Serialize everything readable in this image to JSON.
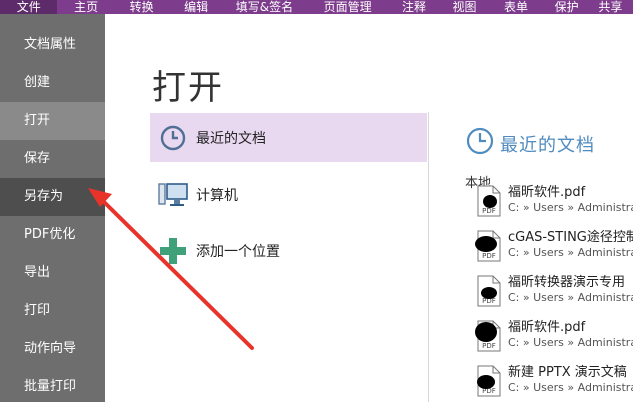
{
  "colors": {
    "menubar": "#7e3d8c",
    "sidebar": "#6e6e6e",
    "selected_place": "#e8d8f0",
    "accent": "#4f8bbf",
    "annotation_arrow": "#e8332a"
  },
  "menubar": {
    "tabs": [
      "文件",
      "主页",
      "转换",
      "编辑",
      "填写&签名",
      "页面管理",
      "注释",
      "视图",
      "表单",
      "保护",
      "共享"
    ]
  },
  "sidebar": {
    "items": [
      "文档属性",
      "创建",
      "打开",
      "保存",
      "另存为",
      "PDF优化",
      "导出",
      "打印",
      "动作向导",
      "批量打印"
    ]
  },
  "main": {
    "title": "打开",
    "places": [
      {
        "label": "最近的文档",
        "icon": "clock-icon"
      },
      {
        "label": "计算机",
        "icon": "computer-icon"
      },
      {
        "label": "添加一个位置",
        "icon": "plus-icon"
      }
    ]
  },
  "recent": {
    "title": "最近的文档",
    "section": "本地",
    "files": [
      {
        "name": "福昕软件.pdf",
        "path": "C: » Users » Administra"
      },
      {
        "name": "cGAS-STING途径控制",
        "path": "C: » Users » Administra"
      },
      {
        "name": "福昕转换器演示专用",
        "path": "C: » Users » Administra"
      },
      {
        "name": "福昕软件.pdf",
        "path": "C: » Users » Administra"
      },
      {
        "name": "新建 PPTX 演示文稿",
        "path": "C: » Users » Administra"
      }
    ]
  }
}
